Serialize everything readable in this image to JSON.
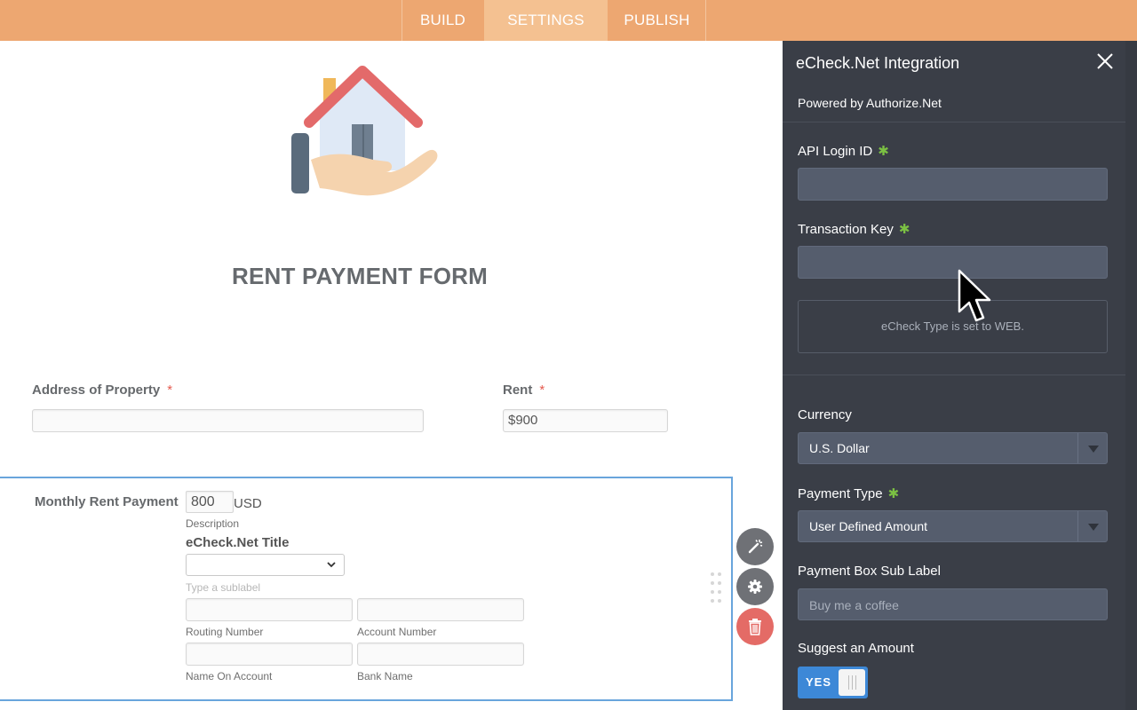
{
  "nav": {
    "tabs": [
      {
        "label": "BUILD"
      },
      {
        "label": "SETTINGS",
        "active": true
      },
      {
        "label": "PUBLISH"
      }
    ]
  },
  "form": {
    "title": "RENT PAYMENT FORM",
    "address": {
      "label": "Address of Property",
      "required_mark": "*",
      "value": ""
    },
    "rent": {
      "label": "Rent",
      "required_mark": "*",
      "value": "$900"
    },
    "payment": {
      "label": "Monthly Rent Payment",
      "amount": "800",
      "currency": "USD",
      "description": "Description",
      "echeck_title": "eCheck.Net Title",
      "sublabel_placeholder": "Type a sublabel",
      "routing_label": "Routing Number",
      "account_label": "Account Number",
      "name_label": "Name On Account",
      "bank_label": "Bank Name"
    }
  },
  "panel": {
    "title": "eCheck.Net Integration",
    "powered_by": "Powered by Authorize.Net",
    "api_login_label": "API Login ID",
    "transaction_key_label": "Transaction Key",
    "required_star": "✱",
    "info_text": "eCheck Type is set to WEB.",
    "currency_label": "Currency",
    "currency_value": "U.S. Dollar",
    "payment_type_label": "Payment Type",
    "payment_type_value": "User Defined Amount",
    "sub_label_label": "Payment Box Sub Label",
    "sub_label_placeholder": "Buy me a coffee",
    "suggest_label": "Suggest an Amount",
    "toggle_text": "YES"
  },
  "icons": {
    "close": "close-icon",
    "wand": "magic-wand-icon",
    "gear": "gear-icon",
    "trash": "trash-icon",
    "logo": "house-in-hand-icon",
    "dropdown": "chevron-down-icon"
  },
  "colors": {
    "topbar": "#eda771",
    "active_tab": "#f4c191",
    "panel_bg": "#3a3e47",
    "input_bg": "#555d6d",
    "required_red": "#e55a4e",
    "required_green": "#7bc043",
    "toggle_blue": "#3d88d7",
    "selection_blue": "#69a5dc",
    "delete_red": "#e46b66"
  }
}
